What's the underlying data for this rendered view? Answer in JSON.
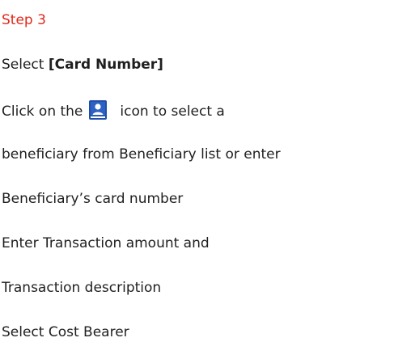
{
  "step": {
    "title": "Step 3"
  },
  "instructions": {
    "select_prefix": "Select ",
    "select_bold": "[Card Number]",
    "click_prefix": "Click on the",
    "click_suffix": "icon to select a",
    "beneficiary_line": "beneficiary from Beneficiary list or enter",
    "card_number_line": "Beneficiary’s card number",
    "amount_line": "Enter Transaction amount and",
    "description_line": "Transaction description",
    "cost_line": "Select Cost Bearer"
  },
  "icons": {
    "beneficiary_book": "beneficiary-book-icon"
  },
  "colors": {
    "step_title": "#e0281b",
    "icon": "#1f4fa8"
  }
}
